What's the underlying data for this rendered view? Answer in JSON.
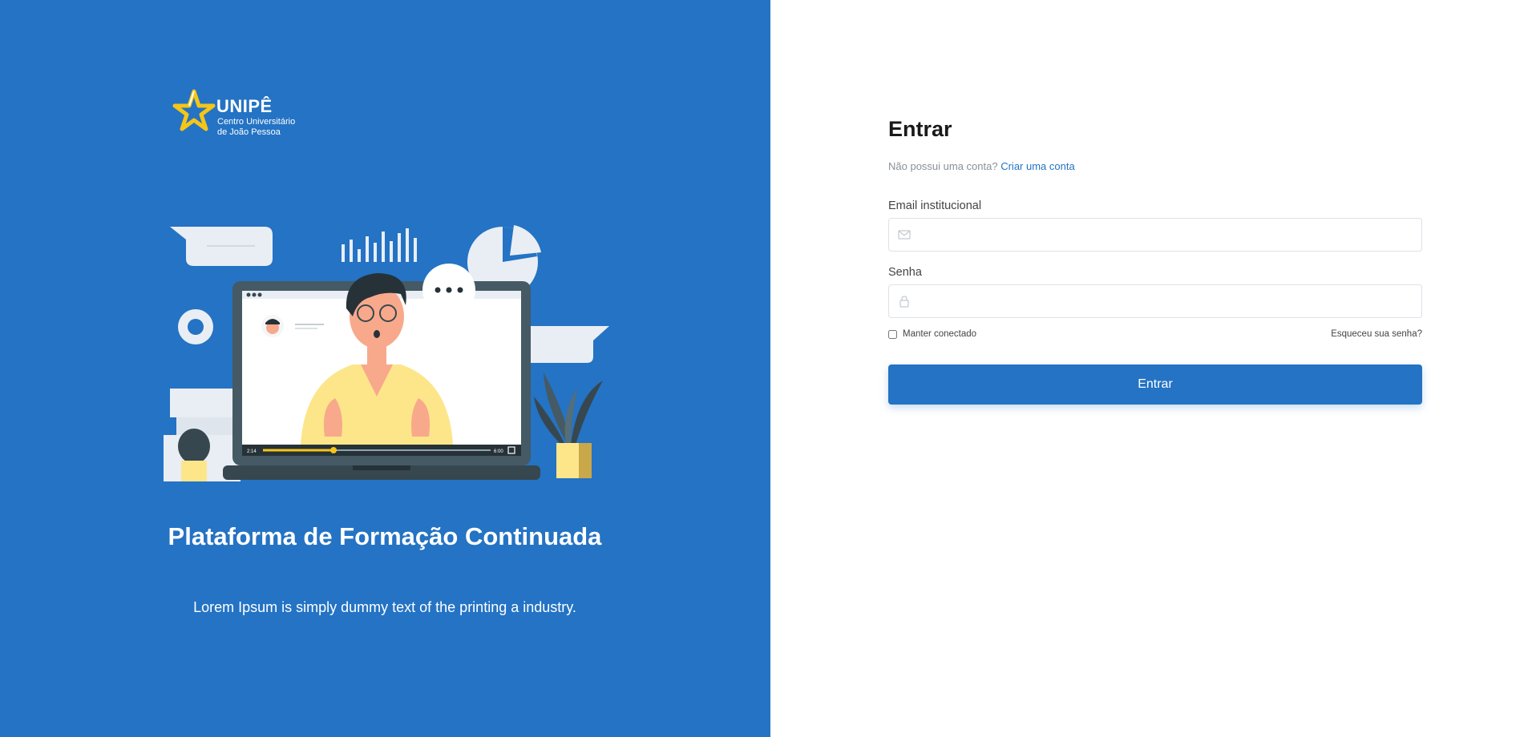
{
  "brand": {
    "name": "UNIPÊ",
    "subtitle_line1": "Centro Universitário",
    "subtitle_line2": "de João Pessoa"
  },
  "hero": {
    "title": "Plataforma de Formação Continuada",
    "subtitle": "Lorem Ipsum is simply dummy text of the printing a industry.",
    "video_time_current": "2:14",
    "video_time_total": "6:00",
    "video_progress": 0.31
  },
  "login": {
    "title": "Entrar",
    "signup_prompt": "Não possui uma conta?",
    "signup_link": "Criar uma conta",
    "email_label": "Email institucional",
    "email_value": "",
    "password_label": "Senha",
    "password_value": "",
    "remember_label": "Manter conectado",
    "remember_checked": false,
    "forgot_link": "Esqueceu sua senha?",
    "submit_label": "Entrar"
  },
  "icons": {
    "email": "envelope-icon",
    "password": "lock-icon",
    "logo": "star-logo-icon"
  },
  "colors": {
    "primary": "#2473c4",
    "logo_yellow": "#f5c518",
    "illustration_yellow": "#fde68a",
    "laptop_dark": "#455a64"
  }
}
